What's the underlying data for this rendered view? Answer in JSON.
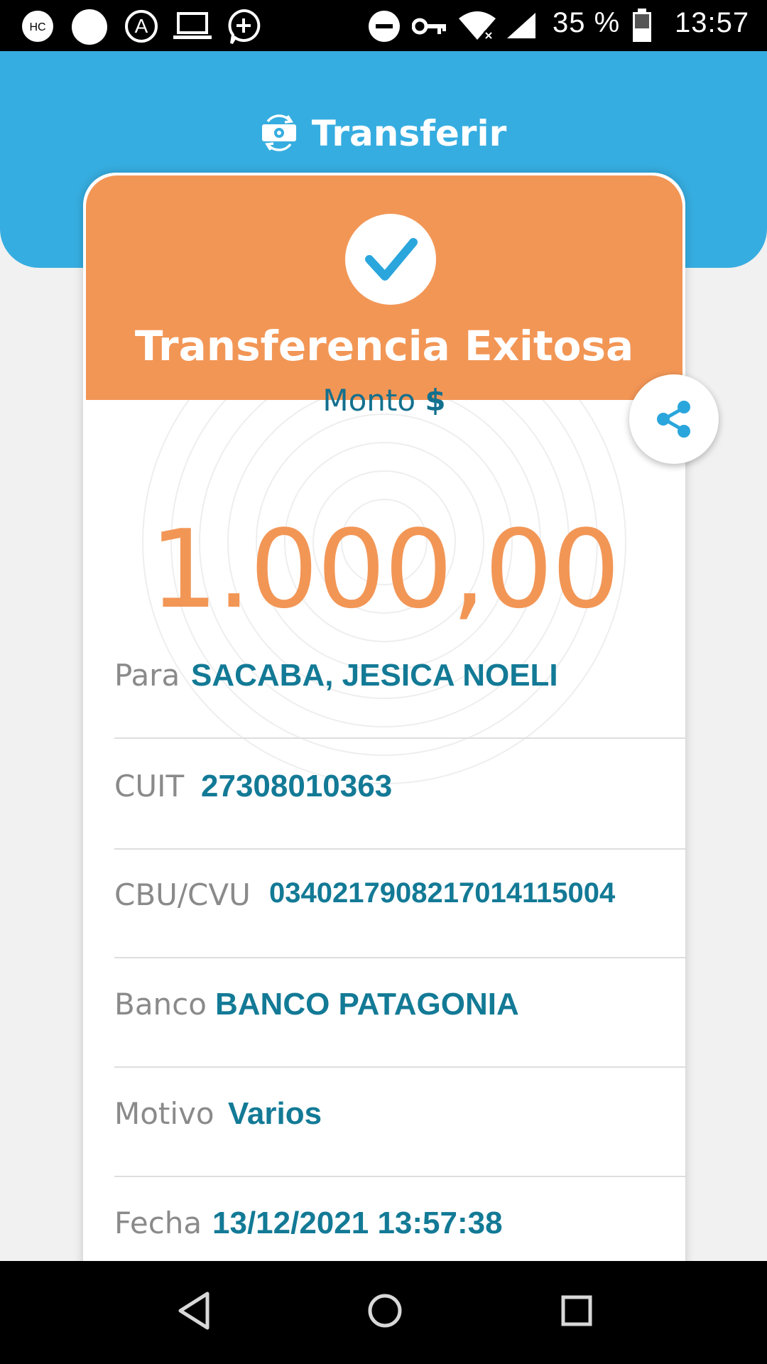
{
  "status_bar": {
    "battery_text": "35 %",
    "time": "13:57",
    "icons": [
      "hc-icon",
      "dot-icon",
      "auto-a-icon",
      "laptop-icon",
      "plus-bubble-icon",
      "dnd-icon",
      "vpn-key-icon",
      "wifi-icon",
      "signal-icon",
      "battery-icon"
    ]
  },
  "header": {
    "title": "Transferir",
    "icon": "money-transfer-icon"
  },
  "result": {
    "title": "Transferencia Exitosa",
    "icon": "check-icon"
  },
  "amount": {
    "label": "Monto",
    "currency": "$",
    "value": "1.000,00"
  },
  "details": [
    {
      "label": "Para",
      "value": "SACABA, JESICA NOELI"
    },
    {
      "label": "CUIT",
      "value": "27308010363"
    },
    {
      "label": "CBU/CVU",
      "value": "0340217908217014115004"
    },
    {
      "label": "Banco",
      "value": "BANCO PATAGONIA"
    },
    {
      "label": "Motivo",
      "value": "Varios"
    },
    {
      "label": "Fecha",
      "value": "13/12/2021 13:57:38"
    }
  ],
  "share": {
    "icon": "share-icon"
  },
  "nav": {
    "icons": [
      "back-icon",
      "home-icon",
      "recents-icon"
    ]
  },
  "colors": {
    "header_blue": "#36ade0",
    "success_orange": "#f29656",
    "value_teal": "#137a96",
    "label_gray": "#8a8a8a"
  }
}
